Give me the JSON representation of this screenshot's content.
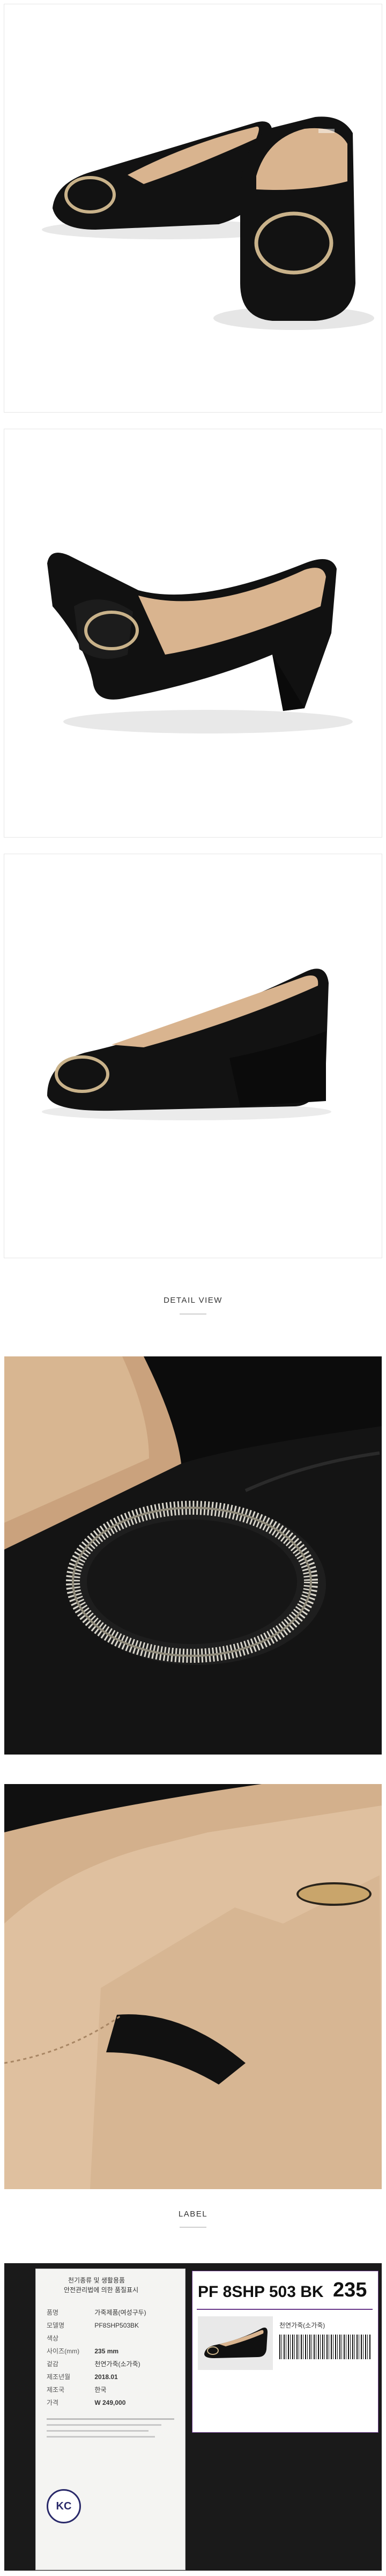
{
  "sections": {
    "detail_title": "DETAIL VIEW",
    "label_title": "LABEL"
  },
  "label_info": {
    "heading_line1": "천기종류 및 생활용품",
    "heading_line2": "안전관리법에 의한 품질표시",
    "rows": [
      {
        "key": "품명",
        "value": "가죽제품(여성구두)"
      },
      {
        "key": "모델명",
        "value": "PF8SHP503BK"
      },
      {
        "key": "색상",
        "value": ""
      },
      {
        "key": "사이즈(mm)",
        "value": "235 mm"
      },
      {
        "key": "겉감",
        "value": "천연가죽(소가죽)"
      },
      {
        "key": "제조년월",
        "value": "2018.01"
      },
      {
        "key": "제조국",
        "value": "한국"
      },
      {
        "key": "가격",
        "value": "W 249,000"
      }
    ],
    "kc_mark": "KC"
  },
  "tag": {
    "code": "PF 8SHP 503 BK",
    "size": "235",
    "material": "천연가죽(소가죽)"
  },
  "colors": {
    "leather": "#111111",
    "lining": "#d9b48f",
    "buckle": "#c9b28a",
    "tag_border": "#6a3a8a"
  }
}
